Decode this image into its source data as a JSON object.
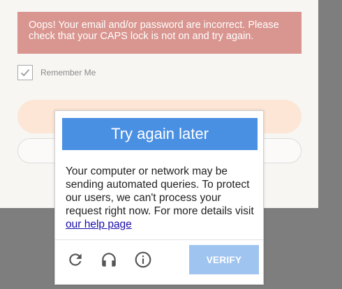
{
  "login": {
    "error_message": "Oops! Your email and/or password are incorrect. Please check that your CAPS lock is not on and try again.",
    "remember_me_label": "Remember Me",
    "remember_me_checked": true
  },
  "captcha": {
    "header": "Try again later",
    "message": "Your computer or network may be sending automated queries. To protect our users, we can't process your request right now. For more details visit ",
    "help_link": "our help page",
    "verify_label": "VERIFY",
    "icons": [
      "reload-icon",
      "headphones-icon",
      "info-icon"
    ]
  },
  "colors": {
    "error_banner": "#d9958f",
    "header_blue": "#4a90e2",
    "verify_disabled": "#9fc4ef",
    "overlay": "#7f7e7e"
  }
}
